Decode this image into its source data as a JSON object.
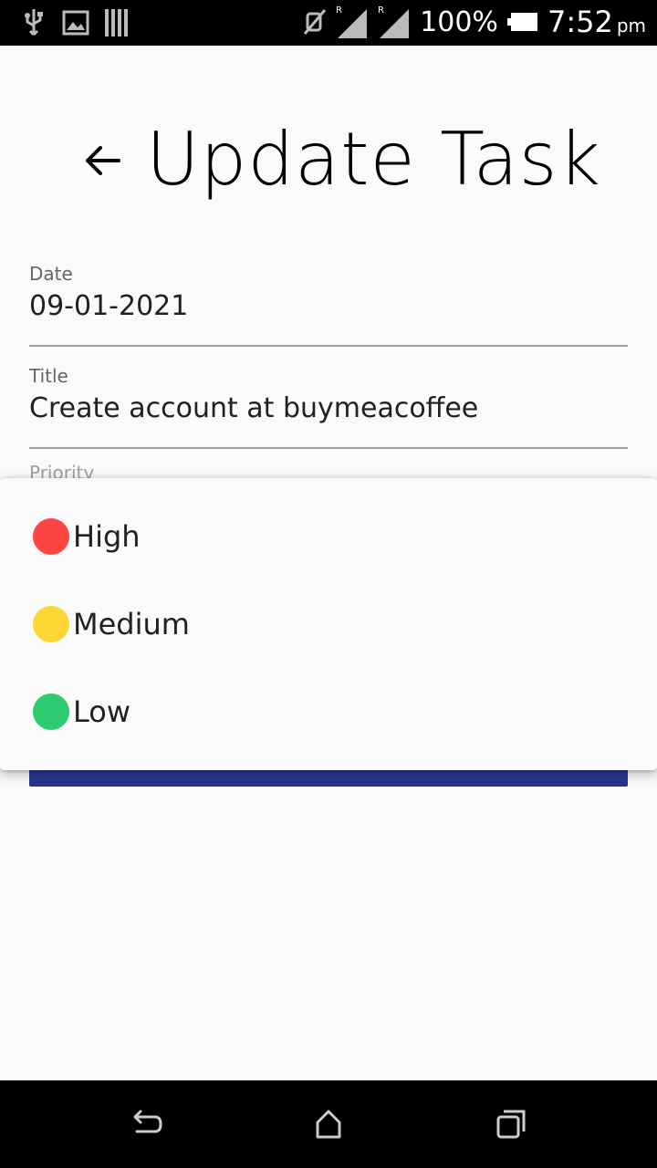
{
  "status_bar": {
    "battery_percent": "100%",
    "time": "7:52",
    "ampm": "pm",
    "icons": [
      "usb-icon",
      "image-icon",
      "barcode-icon",
      "mute-icon",
      "signal-r-icon",
      "signal-r-icon",
      "battery-icon"
    ]
  },
  "header": {
    "title": "Update Task",
    "back_icon": "arrow-left-icon"
  },
  "form": {
    "date": {
      "label": "Date",
      "value": "09-01-2021"
    },
    "title": {
      "label": "Title",
      "value": "Create account at buymeacoffee"
    },
    "priority": {
      "label": "Priority"
    }
  },
  "priority_menu": {
    "items": [
      {
        "label": "High",
        "color": "#ff4444"
      },
      {
        "label": "Medium",
        "color": "#fdd835"
      },
      {
        "label": "Low",
        "color": "#2ecc71"
      }
    ]
  },
  "colors": {
    "submit_button": "#283593"
  },
  "nav_bar": {
    "icons": [
      "back-icon",
      "home-icon",
      "recents-icon"
    ]
  }
}
